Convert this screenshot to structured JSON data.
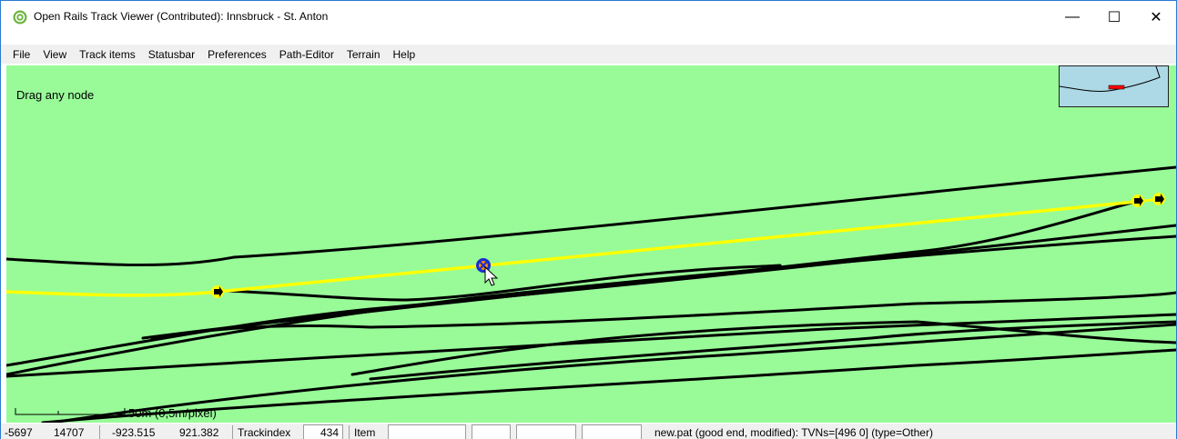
{
  "window": {
    "title": "Open Rails Track Viewer (Contributed): Innsbruck - St. Anton",
    "minimize_glyph": "—",
    "maximize_glyph": "☐",
    "close_glyph": "✕"
  },
  "menu": {
    "items": [
      "File",
      "View",
      "Track items",
      "Statusbar",
      "Preferences",
      "Path-Editor",
      "Terrain",
      "Help"
    ]
  },
  "canvas": {
    "hint": "Drag any node",
    "scale_label": "50m (0,5m/pixel)",
    "colors": {
      "background": "#98fb98",
      "track": "#000000",
      "path": "#ffff00",
      "selected_node": "#1a2bd1",
      "minimap": "#add8e6"
    }
  },
  "statusbar": {
    "tile_x": "-5697",
    "tile_z": "14707",
    "world_x": "-923.515",
    "world_z": "921.382",
    "trackindex_label": "Trackindex",
    "trackindex_value": "434",
    "item_label": "Item",
    "item_value": "",
    "field3": "",
    "field4": "",
    "field5": "",
    "path_status": "new.pat (good end, modified): TVNs=[496 0] (type=Other)"
  }
}
